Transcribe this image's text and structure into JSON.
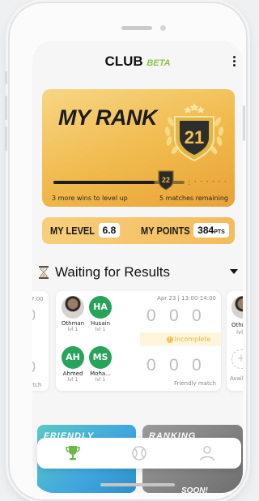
{
  "app": {
    "brand": "CLUB",
    "brand_suffix": "BETA"
  },
  "rank_card": {
    "title": "MY RANK",
    "rank": "21",
    "next_rank": "22",
    "progress_fraction": 0.77,
    "wins_text": "3 more wins to level up",
    "matches_text": "5 matches remaining",
    "colors": {
      "gold_light": "#f7d684",
      "gold_dark": "#e9a237"
    }
  },
  "stats": {
    "level_label": "MY LEVEL",
    "level_value": "6.8",
    "points_label": "MY POINTS",
    "points_value": "384",
    "points_unit": "PTS"
  },
  "section": {
    "title": "Waiting for Results"
  },
  "left_card": {
    "time": "7:00",
    "zero_top": "0",
    "zero_bottom": "0",
    "tag": "atch"
  },
  "match": {
    "date": "Apr 23 | 13:00-14:00",
    "players": [
      {
        "name": "Othman",
        "level": "lvl 1",
        "initials": "",
        "avatar": "photo"
      },
      {
        "name": "Husain",
        "level": "lvl 1",
        "initials": "HA",
        "avatar": "green"
      },
      {
        "name": "Ahmed",
        "level": "lvl 1",
        "initials": "AH",
        "avatar": "green"
      },
      {
        "name": "Moha...",
        "level": "lvl 1",
        "initials": "MS",
        "avatar": "green"
      }
    ],
    "scores_top": [
      "0",
      "0",
      "0"
    ],
    "scores_bottom": [
      "0",
      "0",
      "0"
    ],
    "status": "Incomplete",
    "type": "Friendly match"
  },
  "right_card": {
    "name": "Othm",
    "level": "lvl",
    "avail": "Avail"
  },
  "promos": {
    "left_label": "FRIENDLY",
    "right_label": "RANKING",
    "soon": "SOON!"
  },
  "tabbar": {
    "tabs": [
      {
        "icon": "trophy-icon",
        "active": true
      },
      {
        "icon": "tennis-ball-icon",
        "active": false
      },
      {
        "icon": "profile-icon",
        "active": false
      }
    ],
    "active_color": "#6bb84a",
    "inactive_color": "#c8c8c8"
  }
}
